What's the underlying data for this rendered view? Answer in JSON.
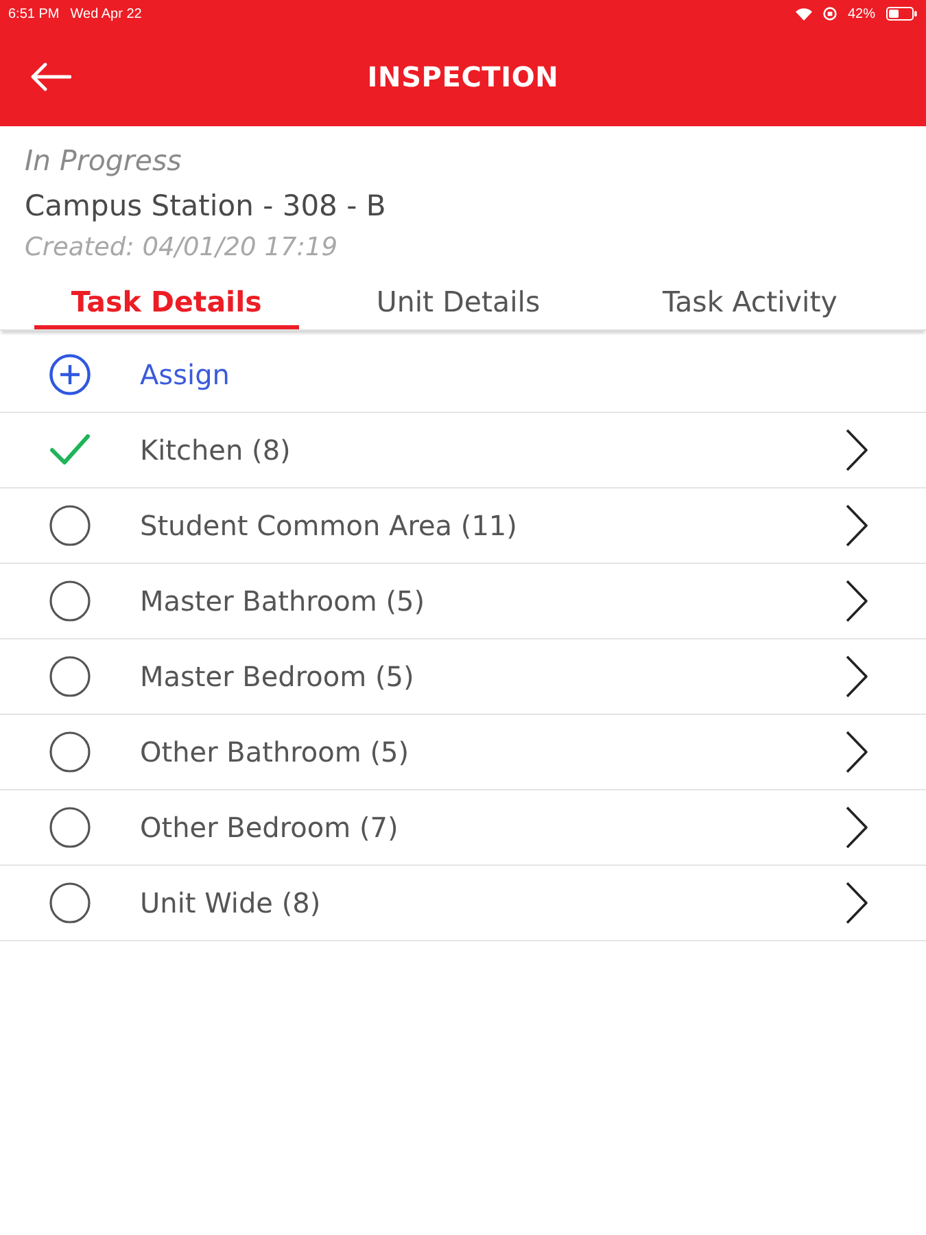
{
  "status_bar": {
    "time": "6:51 PM",
    "date": "Wed Apr 22",
    "battery": "42%"
  },
  "header": {
    "title": "INSPECTION"
  },
  "task": {
    "status": "In Progress",
    "unit": "Campus Station - 308 - B",
    "created": "Created: 04/01/20 17:19"
  },
  "tabs": [
    {
      "label": "Task Details",
      "selected": true
    },
    {
      "label": "Unit Details",
      "selected": false
    },
    {
      "label": "Task Activity",
      "selected": false
    }
  ],
  "assign": {
    "label": "Assign"
  },
  "areas": [
    {
      "name": "Kitchen (8)",
      "completed": true
    },
    {
      "name": "Student Common Area (11)",
      "completed": false
    },
    {
      "name": "Master Bathroom (5)",
      "completed": false
    },
    {
      "name": "Master Bedroom (5)",
      "completed": false
    },
    {
      "name": "Other Bathroom (5)",
      "completed": false
    },
    {
      "name": "Other Bedroom (7)",
      "completed": false
    },
    {
      "name": "Unit Wide (8)",
      "completed": false
    }
  ]
}
